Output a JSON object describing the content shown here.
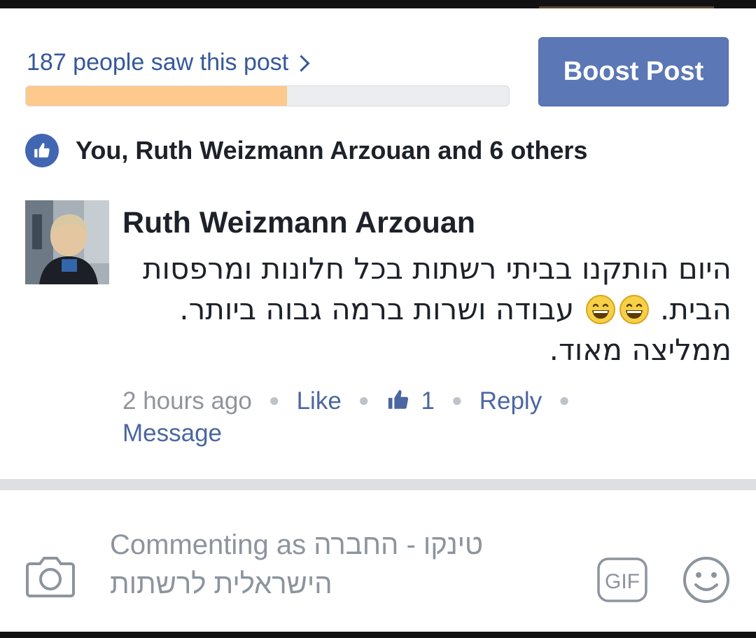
{
  "reach": {
    "label": "187 people saw this post",
    "fraction": 0.54
  },
  "boost_button": {
    "label": "Boost Post"
  },
  "likes": {
    "summary": "You, Ruth Weizmann Arzouan and 6 others"
  },
  "comment": {
    "author": "Ruth Weizmann Arzouan",
    "text_part1": "היום הותקנו בביתי רשתות בכל חלונות ומרפסות הבית.",
    "text_part2": " עבודה ושרות ברמה גבוה ביותר. ממליצה מאוד.",
    "emoji_icon": "grinning-face-emoji",
    "timestamp": "2 hours ago",
    "actions": {
      "like": "Like",
      "like_count": "1",
      "reply": "Reply",
      "message": "Message"
    }
  },
  "composer": {
    "placeholder": "Commenting as טינקו - החברה הישראלית לרשתות"
  },
  "icons": {
    "camera": "camera-icon",
    "gif": "gif-icon",
    "emoji": "smiley-icon",
    "like": "thumbs-up-icon"
  },
  "colors": {
    "link": "#365899",
    "boost": "#5b77b5",
    "reach_fill": "#fdc98d",
    "like_badge": "#4267b2"
  }
}
